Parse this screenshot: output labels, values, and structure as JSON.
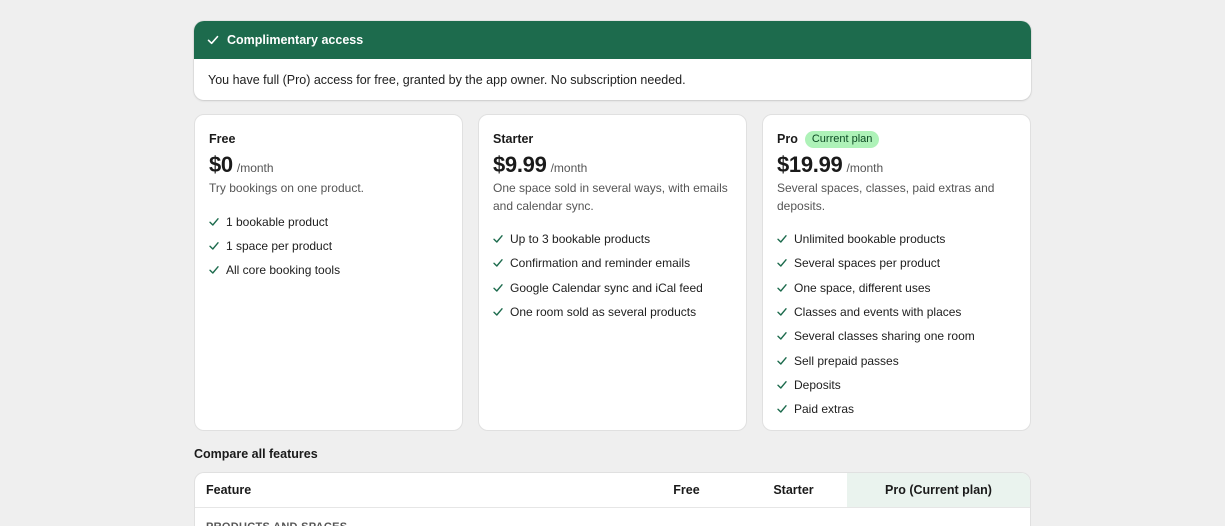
{
  "colors": {
    "banner_bg": "#1d6b4d",
    "check_green": "#1d6b4d",
    "badge_bg": "#aef2b8",
    "pro_column_bg": "#eaf3ee"
  },
  "banner": {
    "icon": "check-icon",
    "title": "Complimentary access",
    "message": "You have full (Pro) access for free, granted by the app owner. No subscription needed."
  },
  "plans": [
    {
      "name": "Free",
      "badge": "",
      "price": "$0",
      "period": "/month",
      "description": "Try bookings on one product.",
      "features": [
        "1 bookable product",
        "1 space per product",
        "All core booking tools"
      ]
    },
    {
      "name": "Starter",
      "badge": "",
      "price": "$9.99",
      "period": "/month",
      "description": "One space sold in several ways, with emails and calendar sync.",
      "features": [
        "Up to 3 bookable products",
        "Confirmation and reminder emails",
        "Google Calendar sync and iCal feed",
        "One room sold as several products"
      ]
    },
    {
      "name": "Pro",
      "badge": "Current plan",
      "price": "$19.99",
      "period": "/month",
      "description": "Several spaces, classes, paid extras and deposits.",
      "features": [
        "Unlimited bookable products",
        "Several spaces per product",
        "One space, different uses",
        "Classes and events with places",
        "Several classes sharing one room",
        "Sell prepaid passes",
        "Deposits",
        "Paid extras"
      ]
    }
  ],
  "compare": {
    "title": "Compare all features",
    "headers": {
      "feature": "Feature",
      "free": "Free",
      "starter": "Starter",
      "pro": "Pro (Current plan)"
    },
    "section_label": "PRODUCTS AND SPACES"
  }
}
